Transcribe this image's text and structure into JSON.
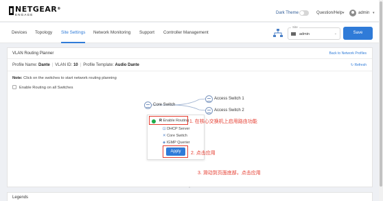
{
  "brand": {
    "name": "NETGEAR",
    "sub": "ENGAGE",
    "trademark": "®"
  },
  "header": {
    "dark_theme_label": "Dark Theme",
    "dark_theme_on": false,
    "help_label": "Question/Help",
    "user_label": "admin"
  },
  "nav": {
    "tabs": [
      {
        "label": "Devices"
      },
      {
        "label": "Topology"
      },
      {
        "label": "Site Settings",
        "active": true
      },
      {
        "label": "Network Monitoring"
      },
      {
        "label": "Support"
      },
      {
        "label": "Controller Management"
      }
    ],
    "site_selector": {
      "label": "Site",
      "value": "admin"
    },
    "save_label": "Save"
  },
  "panel": {
    "title": "VLAN Routing Planner",
    "back_link": "Back to Network Profiles",
    "profile": {
      "name_label": "Profile Name:",
      "name_value": "Dante",
      "vlan_label": "VLAN ID:",
      "vlan_value": "10",
      "template_label": "Profile Template:",
      "template_value": "Audio Dante"
    },
    "refresh_label": "Refresh",
    "note_label": "Note:",
    "note_text": " Click on the switches to start network routing planning",
    "enable_all_label": "Enable Routing on all Switches"
  },
  "topology": {
    "core": "Core Switch",
    "access": [
      "Access Switch 1",
      "Access Switch 2"
    ]
  },
  "context_menu": {
    "items": [
      "Enable Routing",
      "DHCP Server",
      "Core Switch",
      "IGMP Querier"
    ],
    "apply_label": "Apply"
  },
  "annotations": {
    "step1": "1. 在核心交换机上启用路由功能",
    "step2": "2. 点击应用",
    "step3": "3. 滑动到页面底部，点击应用"
  },
  "legends_label": "Legends",
  "colors": {
    "accent": "#2f7bd8",
    "annotation": "#e53b2e",
    "enabled": "#1fab4a"
  }
}
